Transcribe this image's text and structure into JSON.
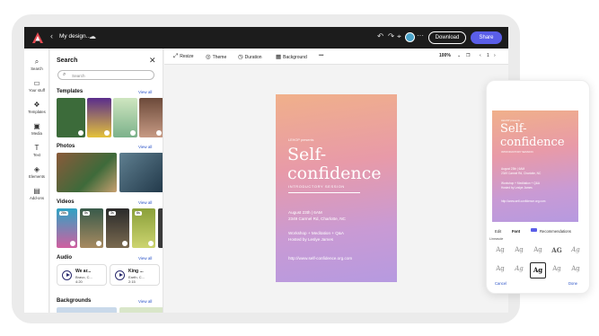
{
  "header": {
    "doc_name": "My design...",
    "download_label": "Download",
    "share_label": "Share",
    "brand_color": "#e34850",
    "share_color": "#5a5ee8"
  },
  "rail": [
    {
      "label": "Search",
      "icon": "search-icon"
    },
    {
      "label": "Your stuff",
      "icon": "folder-icon"
    },
    {
      "label": "Templates",
      "icon": "templates-icon"
    },
    {
      "label": "Media",
      "icon": "media-icon"
    },
    {
      "label": "Text",
      "icon": "text-icon"
    },
    {
      "label": "Elements",
      "icon": "elements-icon"
    },
    {
      "label": "Add-ons",
      "icon": "addons-icon"
    }
  ],
  "panel": {
    "title": "Search",
    "search_placeholder": "Search",
    "sections": {
      "templates": "Templates",
      "photos": "Photos",
      "videos": "Videos",
      "audio": "Audio",
      "backgrounds": "Backgrounds"
    },
    "view_all": "View all",
    "video_durations": [
      "26s",
      "5s",
      "3s",
      "6s"
    ],
    "audio": [
      {
        "title": "We ar...",
        "artist": "Bravo, C...",
        "duration": "4:20"
      },
      {
        "title": "King ...",
        "artist": "Earth, C...",
        "duration": "2:15"
      }
    ]
  },
  "canvas_toolbar": {
    "resize": "Resize",
    "theme": "Theme",
    "duration": "Duration",
    "background": "Background",
    "more": "•••",
    "zoom": "100%",
    "page": "1"
  },
  "poster": {
    "kicker": "LEHOP presents",
    "title_line1": "Self-",
    "title_line2": "confidence",
    "subtitle": "INTRODUCTORY SESSION",
    "date": "August 23th | 6AM",
    "address": "2349 Carmel Rd, Charlotte, NC",
    "line3": "Workshop + Meditation + Q&A",
    "line4": "Hosted by Leslye James",
    "url": "http://www.self-confidence.org.com"
  },
  "phone": {
    "tabs": [
      "Edit",
      "Font",
      "Recommendations"
    ],
    "label": "Lineasde",
    "font_samples": [
      "Ag",
      "Ag",
      "Ag",
      "AG",
      "Ag",
      "Ag",
      "Ag",
      "Ag",
      "Ag",
      "Ag"
    ],
    "cancel": "Cancel",
    "done": "Done"
  }
}
